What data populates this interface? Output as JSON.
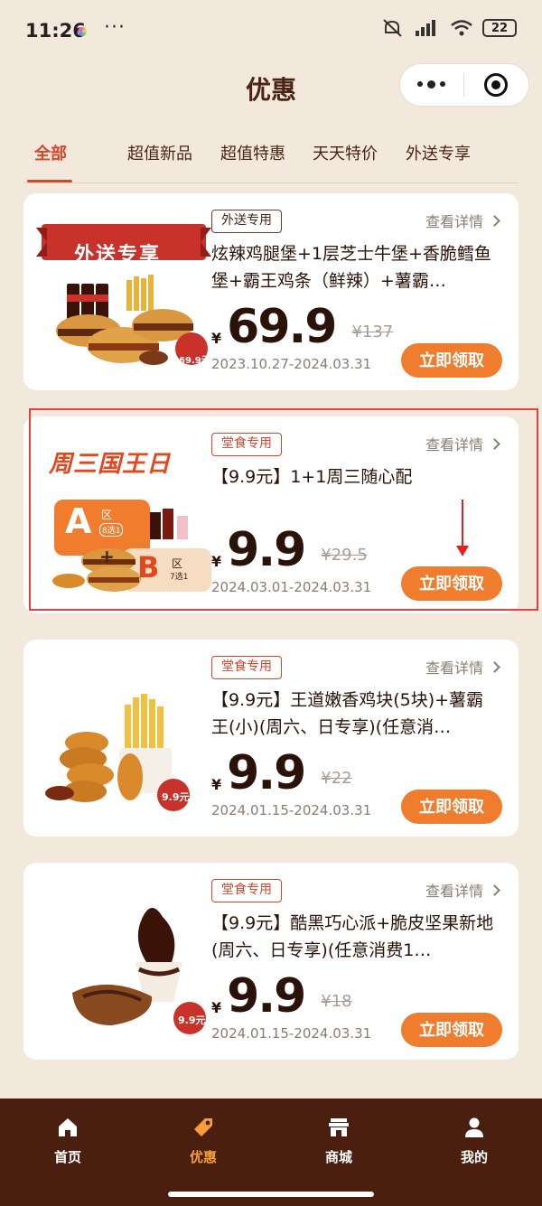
{
  "status": {
    "time": "11:26",
    "dots": "···",
    "battery": "22"
  },
  "header": {
    "title": "优惠"
  },
  "tabs": [
    {
      "label": "全部",
      "active": true
    },
    {
      "label": "超值新品",
      "active": false
    },
    {
      "label": "超值特惠",
      "active": false
    },
    {
      "label": "天天特价",
      "active": false
    },
    {
      "label": "外送专享",
      "active": false
    }
  ],
  "cards": [
    {
      "tag": "外送专用",
      "detail": "查看详情",
      "title": "炫辣鸡腿堡+1层芝士牛堡+香脆鳕鱼堡+霸王鸡条（鲜辣）+薯霸…",
      "currency": "¥",
      "price": "69.9",
      "original": "¥137",
      "date": "2023.10.27-2024.03.31",
      "claim": "立即领取",
      "img_banner": "外送专享",
      "img_badge": "69.9元"
    },
    {
      "tag": "堂食专用",
      "detail": "查看详情",
      "title": "【9.9元】1+1周三随心配",
      "currency": "¥",
      "price": "9.9",
      "original": "¥29.5",
      "date": "2024.03.01-2024.03.31",
      "claim": "立即领取",
      "img_banner": "周三国王日",
      "img_a": "A",
      "img_a_label": "区",
      "img_a_sub": "8选1",
      "img_b": "B",
      "img_b_label": "区",
      "img_b_sub": "7选1"
    },
    {
      "tag": "堂食专用",
      "detail": "查看详情",
      "title": "【9.9元】王道嫩香鸡块(5块)+薯霸王(小)(周六、日专享)(任意消…",
      "currency": "¥",
      "price": "9.9",
      "original": "¥22",
      "date": "2024.01.15-2024.03.31",
      "claim": "立即领取",
      "img_badge": "9.9元"
    },
    {
      "tag": "堂食专用",
      "detail": "查看详情",
      "title": "【9.9元】酷黑巧心派+脆皮坚果新地 (周六、日专享)(任意消费1…",
      "currency": "¥",
      "price": "9.9",
      "original": "¥18",
      "date": "2024.01.15-2024.03.31",
      "claim": "立即领取",
      "img_badge": "9.9元"
    }
  ],
  "nav": [
    {
      "label": "首页",
      "icon": "home-icon",
      "active": false
    },
    {
      "label": "优惠",
      "icon": "coupon-tag-icon",
      "active": true
    },
    {
      "label": "商城",
      "icon": "store-icon",
      "active": false
    },
    {
      "label": "我的",
      "icon": "user-icon",
      "active": false
    }
  ],
  "colors": {
    "accent": "#d9442a",
    "button": "#f07c2e",
    "nav_bg": "#4a1f10",
    "nav_active": "#f3a03a",
    "page_bg": "#f2e8dc"
  }
}
